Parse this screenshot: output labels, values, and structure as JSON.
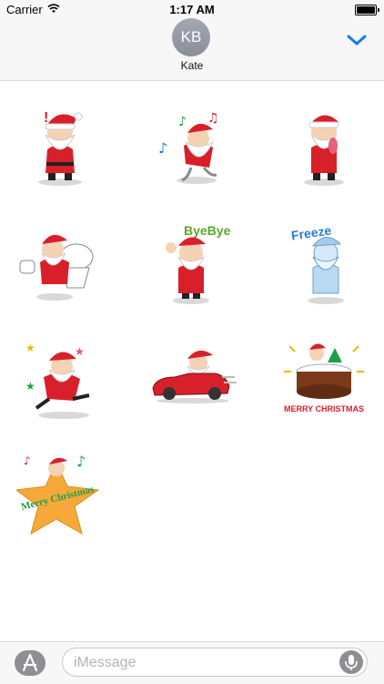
{
  "status_bar": {
    "carrier": "Carrier",
    "time": "1:17 AM",
    "battery_level": 1.0
  },
  "header": {
    "avatar_initials": "KB",
    "contact_name": "Kate"
  },
  "stickers": [
    {
      "icon": "santa-surprised-icon"
    },
    {
      "icon": "santa-dancing-icon"
    },
    {
      "icon": "santa-tongue-out-icon"
    },
    {
      "icon": "santa-toilet-icon"
    },
    {
      "icon": "santa-byebye-icon",
      "text": "ByeBye"
    },
    {
      "icon": "santa-freeze-icon",
      "text": "Freeze"
    },
    {
      "icon": "santa-jumping-icon"
    },
    {
      "icon": "santa-red-car-icon"
    },
    {
      "icon": "santa-christmas-cake-icon",
      "text": "MERRY CHRISTMAS"
    },
    {
      "icon": "santa-star-icon",
      "text": "Merry Christmas"
    }
  ],
  "input_bar": {
    "placeholder": "iMessage"
  },
  "colors": {
    "santa_red": "#d8202a",
    "accent_blue": "#1479f6"
  }
}
